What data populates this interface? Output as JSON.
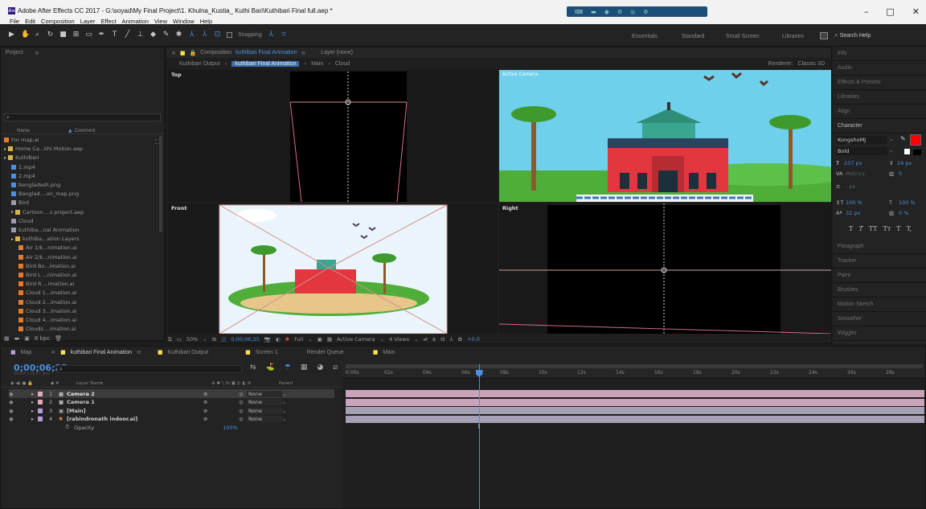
{
  "window": {
    "title": "Adobe After Effects CC 2017 - G:\\soyad\\My Final Project\\1. Khulna_Kustia_ Kuthi Bari\\Kuthibari Final full.aep *",
    "app_badge": "Ae",
    "menus": [
      "File",
      "Edit",
      "Composition",
      "Layer",
      "Effect",
      "Animation",
      "View",
      "Window",
      "Help"
    ],
    "controls": [
      "–",
      "□",
      "✕"
    ]
  },
  "toolbar": {
    "snapping": "Snapping",
    "workspaces": [
      "Essentials",
      "Standard",
      "Small Screen",
      "Libraries"
    ],
    "more": "»",
    "search_placeholder": "Search Help"
  },
  "project_panel": {
    "title": "Project",
    "search_placeholder": "",
    "col_name": "Name",
    "col_comment": "Comment",
    "items": [
      {
        "label": "For map.ai",
        "type": "ai",
        "indent": 0
      },
      {
        "label": "Home Ca...khi Motion.aep",
        "type": "folder",
        "indent": 0
      },
      {
        "label": "KuthiBari",
        "type": "folder",
        "indent": 0
      },
      {
        "label": "1.mp4",
        "type": "video",
        "indent": 1
      },
      {
        "label": "2.mp4",
        "type": "video",
        "indent": 1
      },
      {
        "label": "bangladesh.png",
        "type": "img",
        "indent": 1
      },
      {
        "label": "Banglad....on_map.png",
        "type": "img",
        "indent": 1
      },
      {
        "label": "Bird",
        "type": "comp",
        "indent": 1
      },
      {
        "label": "Cartoon....s project.aep",
        "type": "folder",
        "indent": 1
      },
      {
        "label": "Cloud",
        "type": "comp",
        "indent": 1
      },
      {
        "label": "kuthiba...nal Animation",
        "type": "comp",
        "indent": 1
      },
      {
        "label": "kuthiba...ation Layers",
        "type": "folder",
        "indent": 1
      },
      {
        "label": "Air 1/k...nimation.ai",
        "type": "ai",
        "indent": 2
      },
      {
        "label": "Air 2/k...nimation.ai",
        "type": "ai",
        "indent": 2
      },
      {
        "label": "Bird Bo...imation.ai",
        "type": "ai",
        "indent": 2
      },
      {
        "label": "Bird L ...nimation.ai",
        "type": "ai",
        "indent": 2
      },
      {
        "label": "Bird R ...imation.ai",
        "type": "ai",
        "indent": 2
      },
      {
        "label": "Cloud 1...imation.ai",
        "type": "ai",
        "indent": 2
      },
      {
        "label": "Cloud 2...imation.ai",
        "type": "ai",
        "indent": 2
      },
      {
        "label": "Cloud 3...imation.ai",
        "type": "ai",
        "indent": 2
      },
      {
        "label": "Cloud 4...imation.ai",
        "type": "ai",
        "indent": 2
      },
      {
        "label": "Clouds ...imation.ai",
        "type": "ai",
        "indent": 2
      }
    ],
    "bpc": "8 bpc"
  },
  "composition": {
    "tab_prefix": "Composition",
    "tab_name": "kuthibari Final Animation",
    "layer_tab": "Layer (none)",
    "breadcrumbs": [
      "Kuthibari Output",
      "kuthibari Final Animation",
      "Main",
      "Cloud"
    ],
    "renderer_label": "Renderer:",
    "renderer": "Classic 3D",
    "views": {
      "top": "Top",
      "active": "Active Camera",
      "front": "Front",
      "right": "Right"
    },
    "footer": {
      "zoom": "50%",
      "timecode": "0;00;06;25",
      "quality": "Full",
      "camera": "Active Camera",
      "layout": "4 Views",
      "exposure": "+0.0"
    }
  },
  "right_panels": {
    "items": [
      "Info",
      "Audio",
      "Effects & Presets",
      "Libraries",
      "Align",
      "Character"
    ],
    "character": {
      "font": "KongshoMJ",
      "style": "Bold",
      "size": "237 px",
      "leading": "24 px",
      "kerning": "Metrics",
      "tracking": "0",
      "stroke": "- px",
      "vscale": "100 %",
      "hscale": "100 %",
      "baseline": "32 px",
      "tsume": "0 %",
      "styles": [
        "T",
        "T",
        "TT",
        "Tт",
        "T",
        "T,"
      ]
    },
    "lower": [
      "Paragraph",
      "Tracker",
      "Paint",
      "Brushes",
      "Motion Sketch",
      "Smoother",
      "Wiggler"
    ]
  },
  "timeline": {
    "tabs": [
      "Map",
      "kuthibari Final Animation",
      "Kuthibari Output",
      "Screen 1",
      "Render Queue",
      "Main"
    ],
    "timecode": "0;00;06;25",
    "timecode_sub": "00205 (29.97 fps)",
    "search_placeholder": "",
    "col_layer_name": "Layer Name",
    "col_parent": "Parent",
    "layers": [
      {
        "num": "1",
        "name": "Camera 2",
        "type": "camera",
        "parent": "None",
        "selected": true
      },
      {
        "num": "2",
        "name": "Camera 1",
        "type": "camera",
        "parent": "None",
        "selected": false
      },
      {
        "num": "3",
        "name": "[Main]",
        "type": "comp",
        "parent": "None",
        "selected": false
      },
      {
        "num": "4",
        "name": "[rabindronath indoor.ai]",
        "type": "ai",
        "parent": "None",
        "selected": false
      }
    ],
    "opacity_label": "Opacity",
    "opacity_value": "100%",
    "ruler": [
      "0:00s",
      "02s",
      "04s",
      "06s",
      "08s",
      "10s",
      "12s",
      "14s",
      "16s",
      "18s",
      "20s",
      "22s",
      "24s",
      "26s",
      "28s"
    ],
    "playhead_seconds": 6.9
  },
  "colors": {
    "accent": "#4b8fe0",
    "sky": "#5ec8e8",
    "red": "#e23a3a",
    "green": "#4fae3a",
    "text_color": "#ff0000"
  }
}
